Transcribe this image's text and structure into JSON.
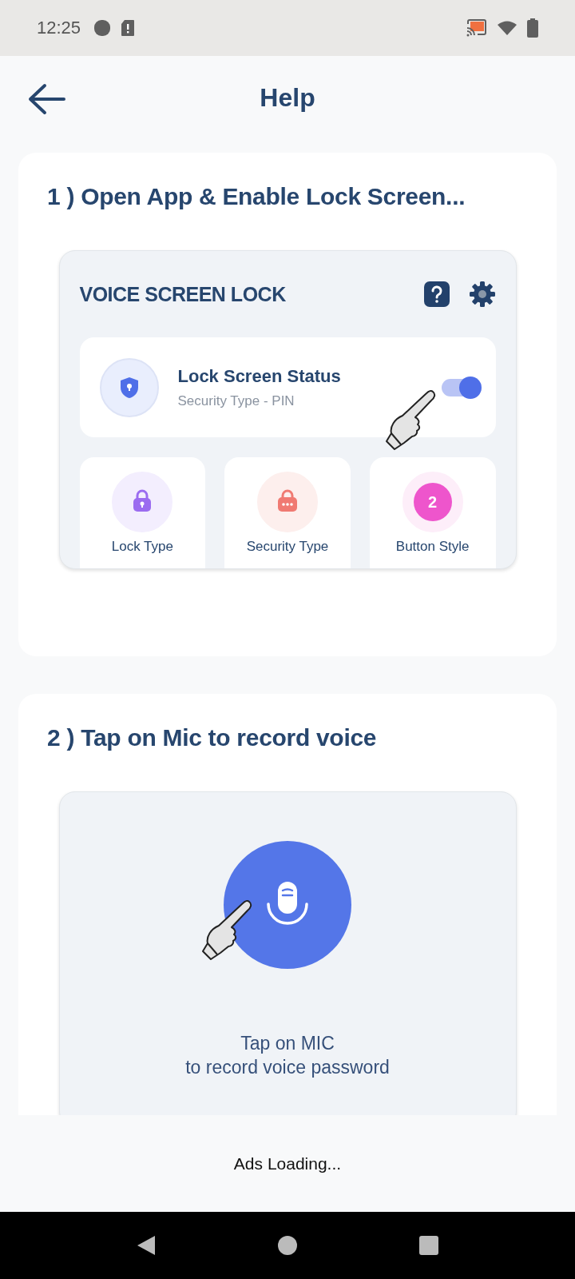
{
  "status_bar": {
    "time": "12:25"
  },
  "app_bar": {
    "title": "Help"
  },
  "steps": [
    {
      "kind": "lock",
      "title": "1 ) Open App & Enable Lock Screen...",
      "preview": {
        "app_title": "VOICE SCREEN LOCK",
        "status_card": {
          "title": "Lock Screen Status",
          "subtitle": "Security Type - PIN",
          "on": true
        },
        "tiles": [
          {
            "kind": "lock",
            "label": "Lock Type",
            "color": "#9b6cf0"
          },
          {
            "kind": "dots",
            "label": "Security Type",
            "color": "#f07a72"
          },
          {
            "kind": "number",
            "label": "Button Style",
            "badge": "2",
            "color": "#ee55cc"
          }
        ]
      }
    },
    {
      "kind": "mic",
      "title": "2 ) Tap on Mic to record voice",
      "preview": {
        "caption": "Tap on MIC\nto record voice password"
      }
    }
  ],
  "ad": {
    "text": "Ads Loading..."
  }
}
